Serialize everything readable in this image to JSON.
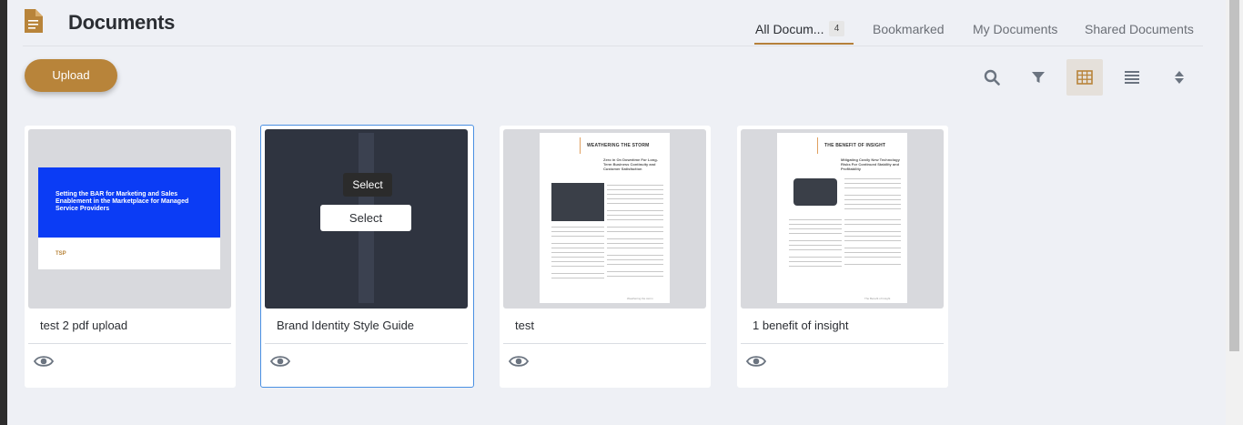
{
  "header": {
    "title": "Documents",
    "tabs": [
      {
        "label": "All Docum...",
        "count": "4"
      },
      {
        "label": "Bookmarked"
      },
      {
        "label": "My Documents"
      },
      {
        "label": "Shared Documents"
      }
    ]
  },
  "toolbar": {
    "upload_label": "Upload",
    "tools": [
      "search-icon",
      "filter-icon",
      "grid-view-icon",
      "list-view-icon",
      "sort-icon"
    ],
    "active_tool": "grid-view-icon"
  },
  "colors": {
    "accent": "#b8843a",
    "selection_border": "#4a90e2",
    "cover_blue": "#0b3cf5"
  },
  "documents": [
    {
      "title": "test 2 pdf upload",
      "cover_text": "Setting the BAR for Marketing and Sales Enablement in the Marketplace for Managed Service Providers",
      "cover_logo": "TSP"
    },
    {
      "title": "Brand Identity Style Guide",
      "tooltip": "Select",
      "select_label": "Select",
      "selected": true
    },
    {
      "title": "test",
      "page_heading": "WEATHERING THE STORM",
      "page_subheading": "Zero in On Downtime For Long-Term Business Continuity and Customer Satisfaction",
      "page_footer": "Weathering the storm"
    },
    {
      "title": "1 benefit of insight",
      "page_heading": "THE BENEFIT OF INSIGHT",
      "page_subheading": "Mitigating Costly New Technology Risks For Continued Stability and Profitability",
      "page_footer": "The Benefit of Insight"
    }
  ]
}
